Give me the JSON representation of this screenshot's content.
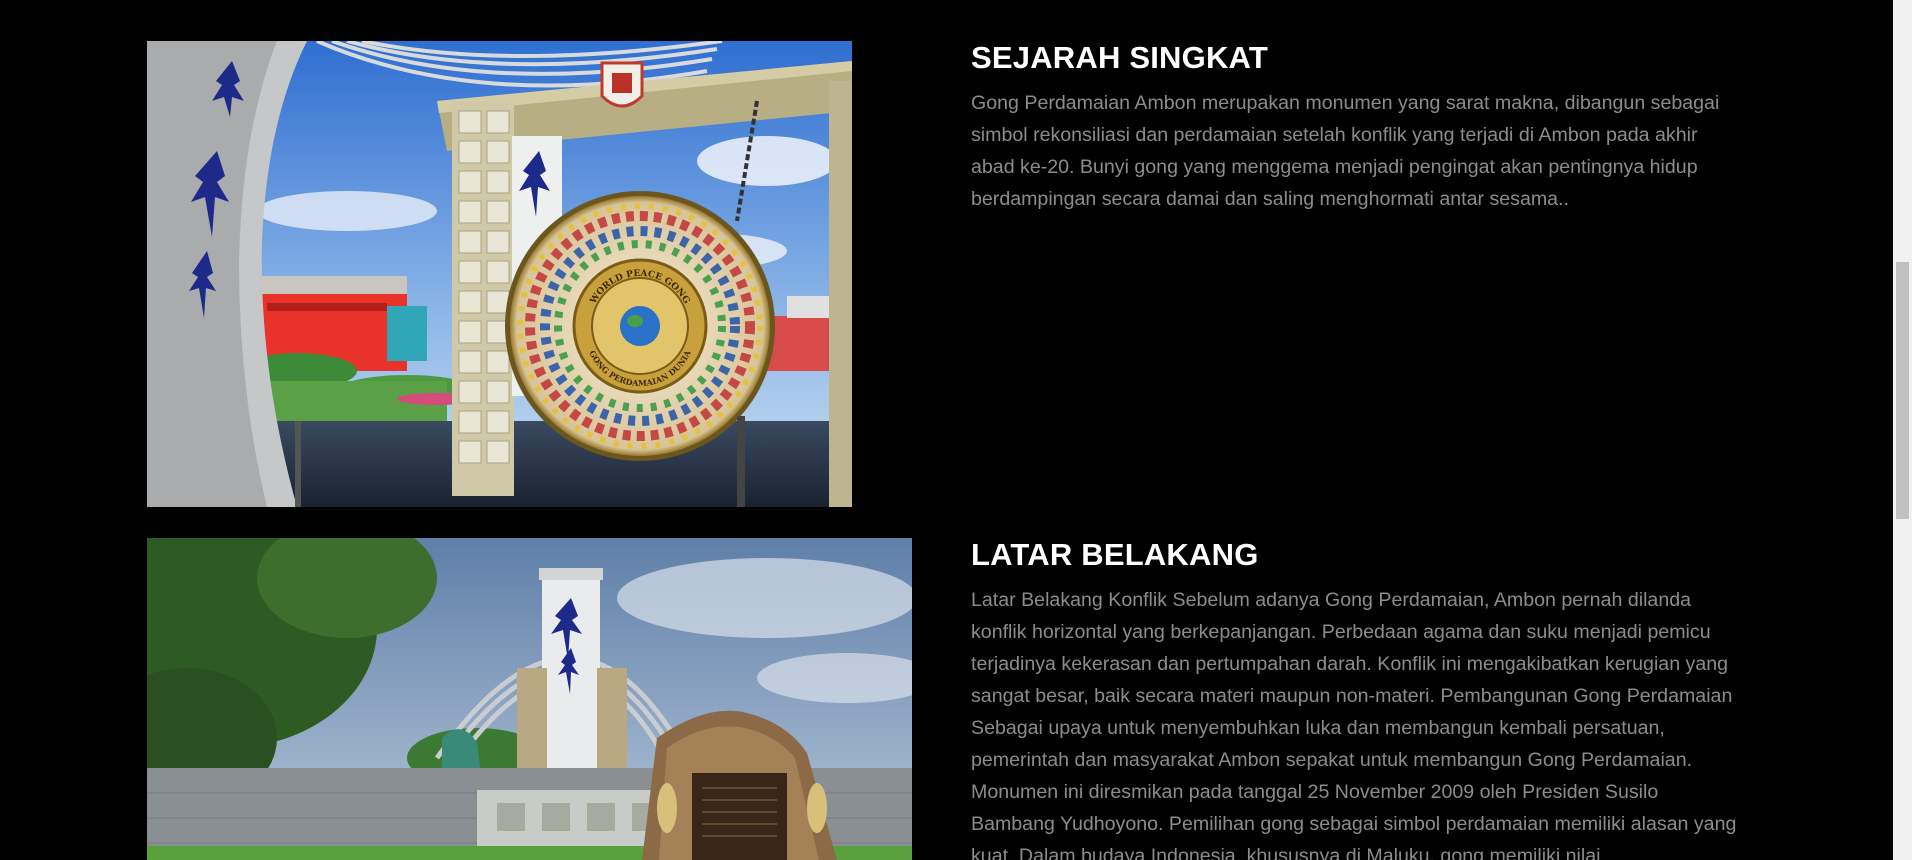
{
  "sections": [
    {
      "title": "SEJARAH SINGKAT",
      "body": "Gong Perdamaian Ambon merupakan monumen yang sarat makna, dibangun sebagai simbol rekonsiliasi dan perdamaian setelah konflik yang terjadi di Ambon pada akhir abad ke-20. Bunyi gong yang menggema menjadi pengingat akan pentingnya hidup berdampingan secara damai dan saling menghormati antar sesama..",
      "gong_text_top": "WORLD PEACE GONG",
      "gong_text_bottom": "GONG PERDAMAIAN DUNIA"
    },
    {
      "title": "LATAR BELAKANG",
      "body": "Latar Belakang Konflik Sebelum adanya Gong Perdamaian, Ambon pernah dilanda konflik horizontal yang berkepanjangan. Perbedaan agama dan suku menjadi pemicu terjadinya kekerasan dan pertumpahan darah. Konflik ini mengakibatkan kerugian yang sangat besar, baik secara materi maupun non-materi. Pembangunan Gong Perdamaian Sebagai upaya untuk menyembuhkan luka dan membangun kembali persatuan, pemerintah dan masyarakat Ambon sepakat untuk membangun Gong Perdamaian. Monumen ini diresmikan pada tanggal 25 November 2009 oleh Presiden Susilo Bambang Yudhoyono. Pemilihan gong sebagai simbol perdamaian memiliki alasan yang kuat. Dalam budaya Indonesia, khususnya di Maluku, gong memiliki nilai"
    }
  ],
  "colors": {
    "background": "#000000",
    "heading": "#ffffff",
    "body_text": "#8c8c8c",
    "scrollbar_track": "#f1f1f1",
    "scrollbar_thumb": "#c1c1c1"
  }
}
